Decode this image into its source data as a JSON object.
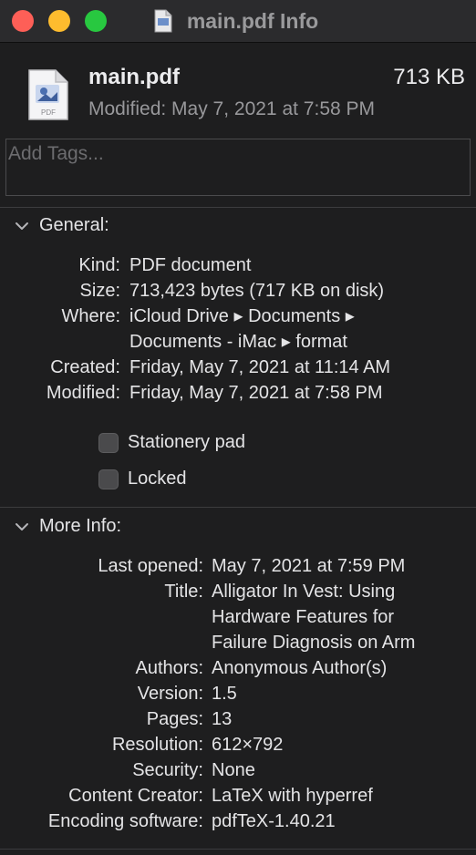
{
  "window": {
    "title": "main.pdf Info"
  },
  "header": {
    "file_name": "main.pdf",
    "file_size": "713 KB",
    "modified": "Modified: May 7, 2021 at 7:58 PM",
    "icon_caption": "PDF"
  },
  "tags": {
    "placeholder": "Add Tags..."
  },
  "general": {
    "heading": "General:",
    "rows": [
      {
        "label": "Kind:",
        "value": "PDF document"
      },
      {
        "label": "Size:",
        "value": "713,423 bytes (717 KB on disk)"
      },
      {
        "label": "Where:",
        "value": "iCloud Drive ▸ Documents ▸"
      },
      {
        "label": "",
        "value": "Documents - iMac ▸ format"
      },
      {
        "label": "Created:",
        "value": "Friday, May 7, 2021 at 11:14 AM"
      },
      {
        "label": "Modified:",
        "value": "Friday, May 7, 2021 at 7:58 PM"
      }
    ],
    "stationery_label": "Stationery pad",
    "locked_label": "Locked"
  },
  "more_info": {
    "heading": "More Info:",
    "rows": [
      {
        "label": "Last opened:",
        "value": "May 7, 2021 at 7:59 PM"
      },
      {
        "label": "Title:",
        "value": "Alligator In Vest: Using"
      },
      {
        "label": "",
        "value": "Hardware Features for"
      },
      {
        "label": "",
        "value": "Failure Diagnosis on Arm"
      },
      {
        "label": "Authors:",
        "value": "Anonymous Author(s)"
      },
      {
        "label": "Version:",
        "value": "1.5"
      },
      {
        "label": "Pages:",
        "value": "13"
      },
      {
        "label": "Resolution:",
        "value": "612×792"
      },
      {
        "label": "Security:",
        "value": "None"
      },
      {
        "label": "Content Creator:",
        "value": "LaTeX with hyperref"
      },
      {
        "label": "Encoding software:",
        "value": "pdfTeX-1.40.21"
      }
    ]
  },
  "icons": [
    "close-button",
    "minimize-button",
    "zoom-button",
    "pdf-file-icon",
    "chevron-down-icon",
    "checkbox"
  ]
}
